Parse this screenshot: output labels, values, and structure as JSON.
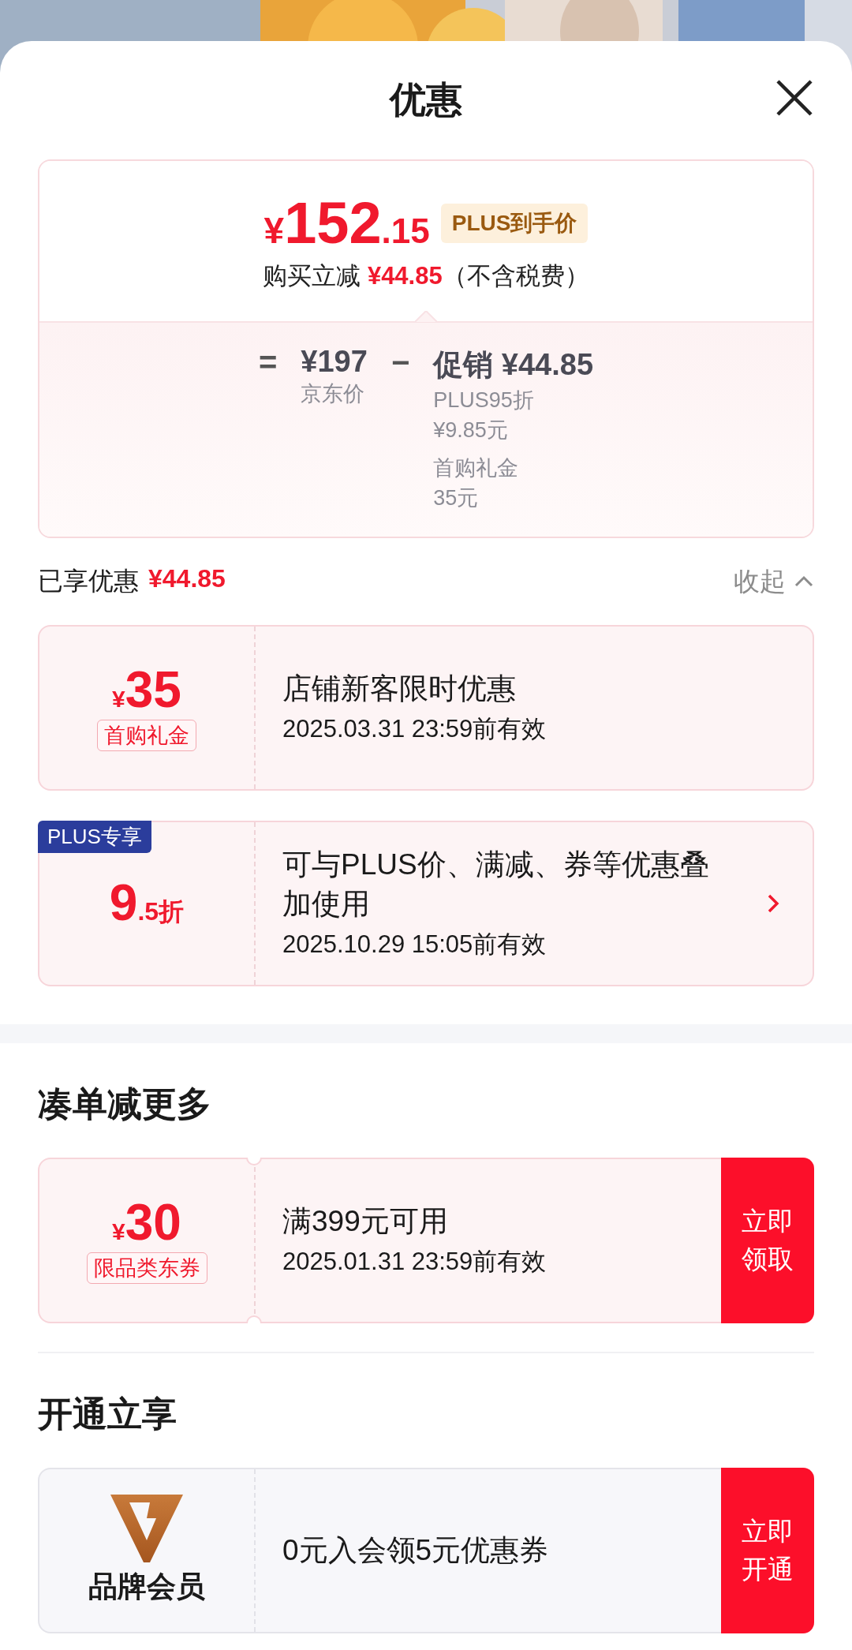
{
  "title": "优惠",
  "summary": {
    "price_symbol": "¥",
    "price_int": "152",
    "price_dec": ".15",
    "price_tag": "PLUS到手价",
    "subtitle_prefix": "购买立减",
    "subtitle_amount": "¥44.85",
    "subtitle_suffix": "（不含税费）",
    "formula": {
      "equals": "=",
      "base_price": "¥197",
      "base_label": "京东价",
      "minus": "−",
      "promo_label": "促销",
      "promo_amount": "¥44.85",
      "details": [
        {
          "name": "PLUS95折",
          "amount": "¥9.85元"
        },
        {
          "name": "首购礼金",
          "amount": "35元"
        }
      ]
    }
  },
  "enjoyed": {
    "label": "已享优惠",
    "amount": "¥44.85",
    "toggle": "收起",
    "expanded": true
  },
  "applied": [
    {
      "kind": "amount",
      "symbol": "¥",
      "value": "35",
      "tag": "首购礼金",
      "title": "店铺新客限时优惠",
      "validity": "2025.03.31 23:59前有效",
      "arrow": false
    },
    {
      "kind": "discount",
      "badge": "PLUS专享",
      "value_int": "9",
      "value_dec": ".5折",
      "title": "可与PLUS价、满减、券等优惠叠加使用",
      "validity": "2025.10.29 15:05前有效",
      "arrow": true
    }
  ],
  "sections": [
    {
      "title": "凑单减更多",
      "coupons": [
        {
          "kind": "amount",
          "symbol": "¥",
          "value": "30",
          "tag": "限品类东券",
          "title": "满399元可用",
          "validity": "2025.01.31 23:59前有效",
          "action": "立即领取"
        }
      ]
    },
    {
      "title": "开通立享",
      "coupons": [
        {
          "kind": "brand",
          "label": "品牌会员",
          "title": "0元入会领5元优惠券",
          "action": "立即开通"
        }
      ]
    }
  ]
}
